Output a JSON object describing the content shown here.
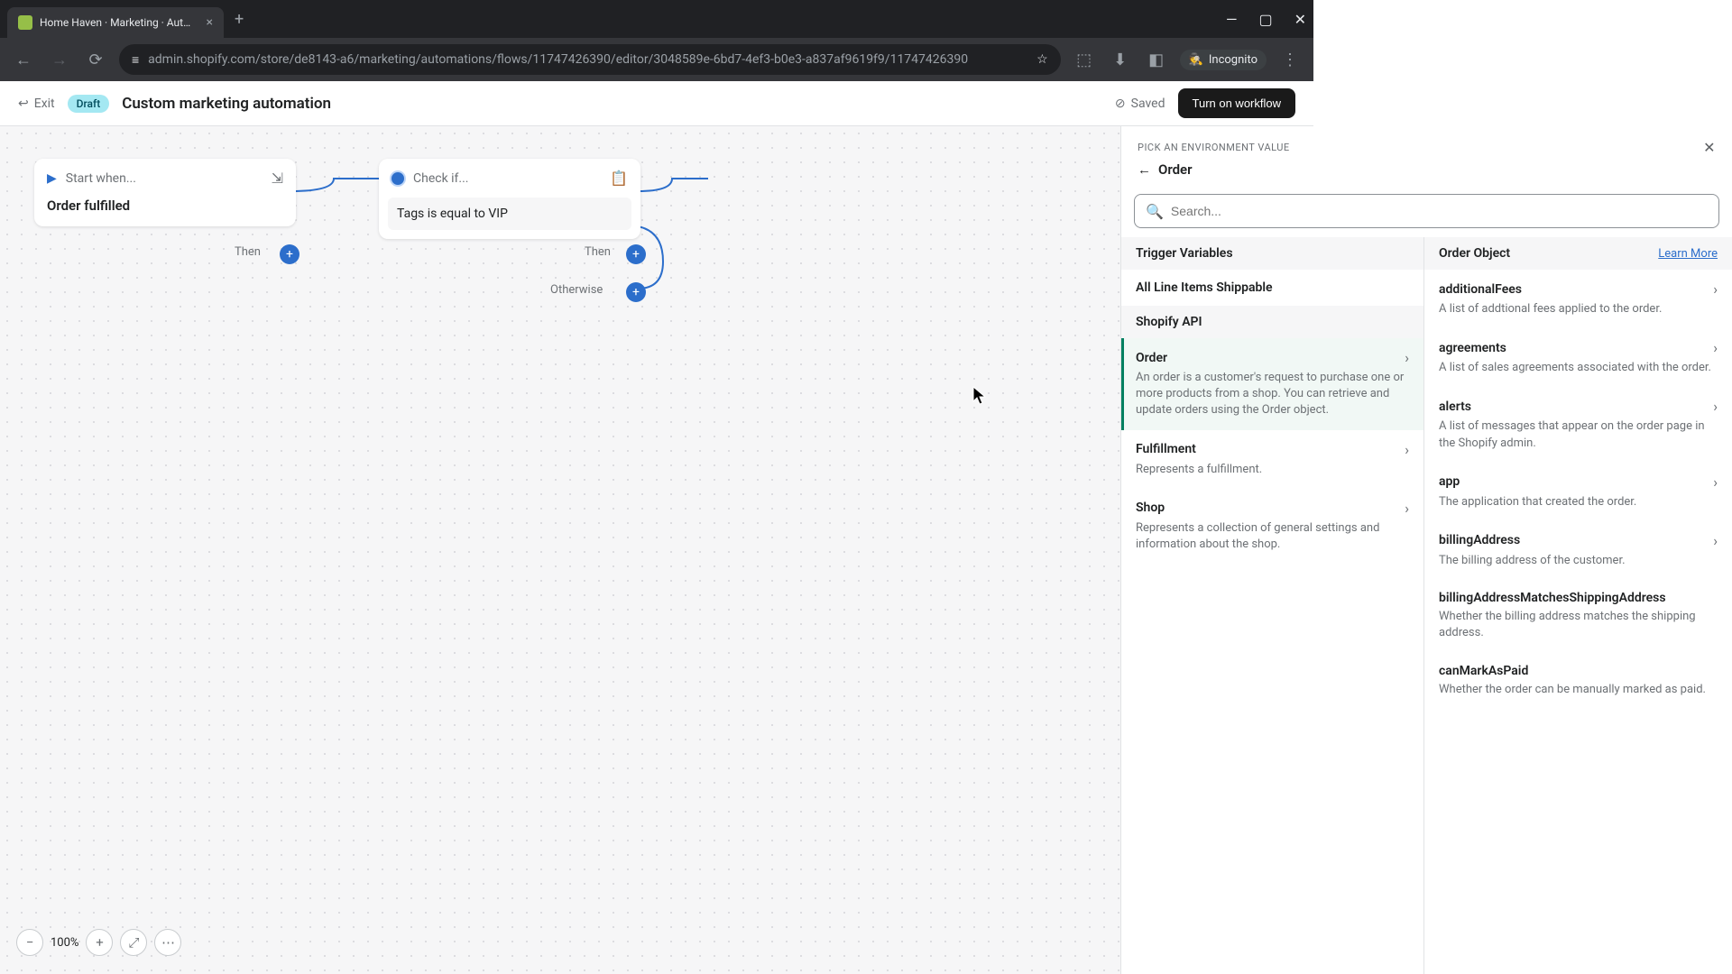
{
  "browser": {
    "tab_title": "Home Haven · Marketing · Aut…",
    "url": "admin.shopify.com/store/de8143-a6/marketing/automations/flows/11747426390/editor/3048589e-6bd7-4ef3-b0e3-a837af9619f9/11747426390",
    "incognito_label": "Incognito"
  },
  "header": {
    "exit_label": "Exit",
    "draft_label": "Draft",
    "title": "Custom marketing automation",
    "saved_label": "Saved",
    "turn_on_label": "Turn on workflow"
  },
  "canvas": {
    "start_node": {
      "title": "Start when...",
      "body": "Order fulfilled"
    },
    "check_node": {
      "title": "Check if...",
      "body": "Tags is equal to VIP"
    },
    "then_label": "Then",
    "otherwise_label": "Otherwise",
    "zoom_level": "100%"
  },
  "panel": {
    "eyebrow": "PICK AN ENVIRONMENT VALUE",
    "close_icon": "✕",
    "back_icon": "←",
    "breadcrumb": "Order",
    "search_placeholder": "Search...",
    "left": {
      "trigger_header": "Trigger Variables",
      "trigger_items": [
        {
          "name": "All Line Items Shippable",
          "desc": ""
        }
      ],
      "api_header": "Shopify API",
      "api_items": [
        {
          "name": "Order",
          "desc": "An order is a customer's request to purchase one or more products from a shop. You can retrieve and update orders using the Order object.",
          "selected": true,
          "chevron": true
        },
        {
          "name": "Fulfillment",
          "desc": "Represents a fulfillment.",
          "chevron": true
        },
        {
          "name": "Shop",
          "desc": "Represents a collection of general settings and information about the shop.",
          "chevron": true
        }
      ]
    },
    "right": {
      "header": "Order Object",
      "learn_more": "Learn More",
      "items": [
        {
          "name": "additionalFees",
          "desc": "A list of addtional fees applied to the order.",
          "chevron": true
        },
        {
          "name": "agreements",
          "desc": "A list of sales agreements associated with the order.",
          "chevron": true
        },
        {
          "name": "alerts",
          "desc": "A list of messages that appear on the order page in the Shopify admin.",
          "chevron": true
        },
        {
          "name": "app",
          "desc": "The application that created the order.",
          "chevron": true
        },
        {
          "name": "billingAddress",
          "desc": "The billing address of the customer.",
          "chevron": true
        },
        {
          "name": "billingAddressMatchesShippingAddress",
          "desc": "Whether the billing address matches the shipping address."
        },
        {
          "name": "canMarkAsPaid",
          "desc": "Whether the order can be manually marked as paid."
        }
      ]
    }
  }
}
